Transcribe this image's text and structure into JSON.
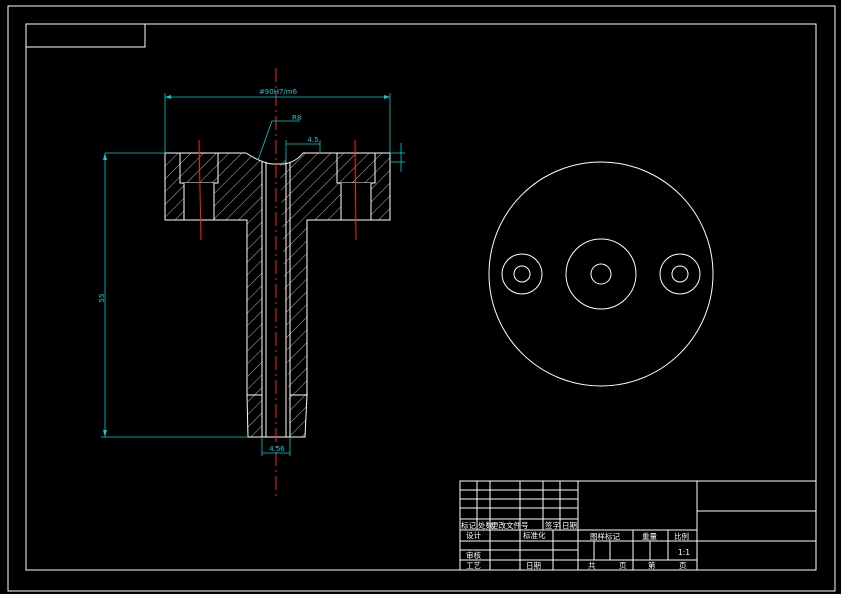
{
  "dimensions": {
    "overall_width": "#90H7/m6",
    "radius": "R8",
    "top_small": "4.5",
    "height": "55",
    "bottom_dia": "4.56"
  },
  "title_block": {
    "header_cells": [
      "标记",
      "处数",
      "更改文件号",
      "签字",
      "日期"
    ],
    "design": "设计",
    "design_mark": "标准化",
    "review": "审核",
    "process": "工艺",
    "date": "日期",
    "stage_mark": "图样标记",
    "weight": "重量",
    "scale_label": "比例",
    "scale": "1:1",
    "total": "共",
    "page1": "页",
    "sheet": "第",
    "page2": "页"
  }
}
